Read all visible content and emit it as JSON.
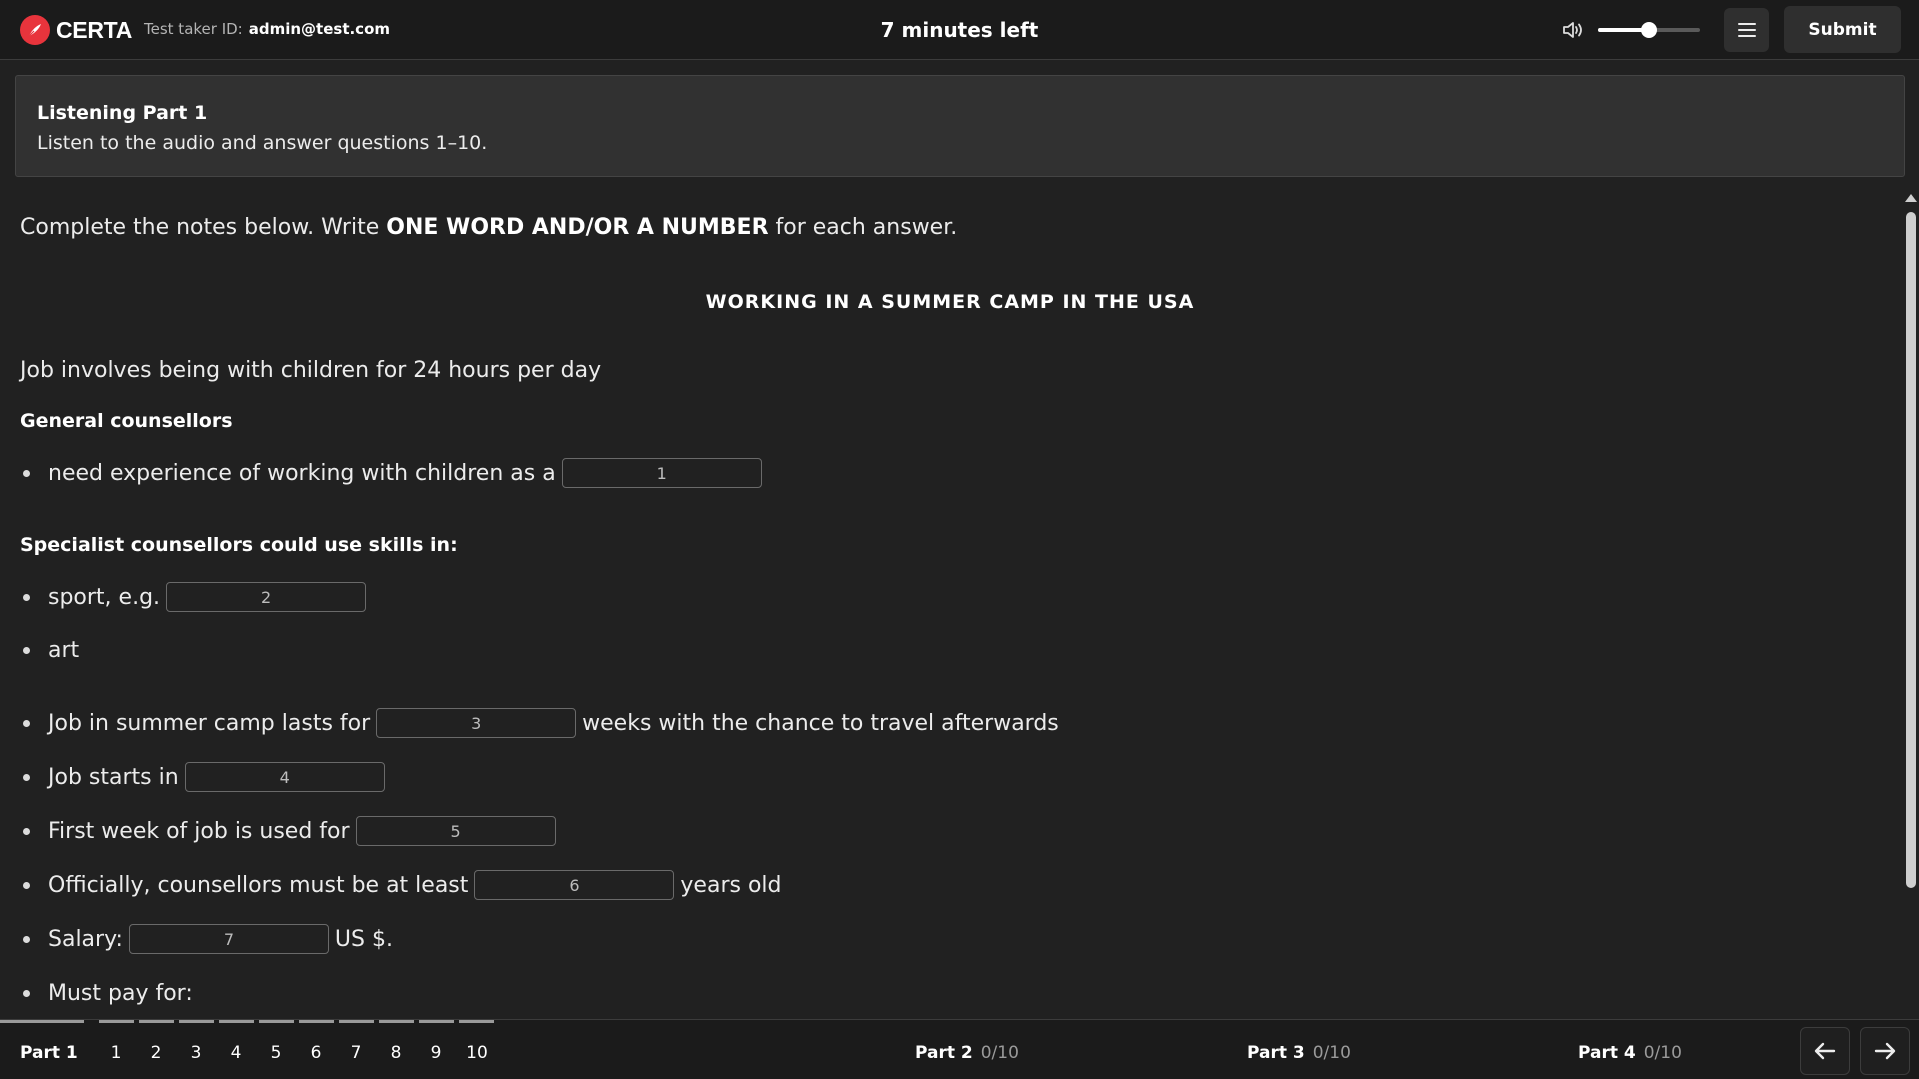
{
  "header": {
    "brand": "CERTA",
    "taker_label": "Test taker ID:",
    "taker_id": "admin@test.com",
    "timer": "7 minutes left",
    "volume_fraction": 0.5,
    "submit_label": "Submit",
    "icons": [
      "certa-logo-icon",
      "speaker-icon",
      "hamburger-menu-icon"
    ]
  },
  "banner": {
    "title": "Listening Part 1",
    "subtitle": "Listen to the audio and answer questions 1–10."
  },
  "content": {
    "instruction_prefix": "Complete the notes below. Write ",
    "instruction_bold": "ONE WORD AND/OR A NUMBER",
    "instruction_suffix": " for each answer.",
    "title": "WORKING IN A SUMMER CAMP IN THE USA",
    "intro": "Job involves being with children for 24 hours per day",
    "general_heading": "General counsellors",
    "q1_before": "need experience of working with children as a",
    "q1_placeholder": "1",
    "specialist_heading": "Specialist counsellors could use skills in:",
    "q2_before": "sport, e.g.",
    "q2_placeholder": "2",
    "art": "art",
    "q3_before": "Job in summer camp lasts for",
    "q3_placeholder": "3",
    "q3_after": "weeks with the chance to travel afterwards",
    "q4_before": "Job starts in",
    "q4_placeholder": "4",
    "q5_before": "First week of job is used for",
    "q5_placeholder": "5",
    "q6_before": "Officially, counsellors must be at least",
    "q6_placeholder": "6",
    "q6_after": "years old",
    "q7_before": "Salary:",
    "q7_placeholder": "7",
    "q7_after": "US $.",
    "must_pay": "Must pay for:"
  },
  "footer": {
    "part1_label": "Part 1",
    "questions": [
      "1",
      "2",
      "3",
      "4",
      "5",
      "6",
      "7",
      "8",
      "9",
      "10"
    ],
    "part2_label": "Part 2",
    "part2_score": "0/10",
    "part3_label": "Part 3",
    "part3_score": "0/10",
    "part4_label": "Part 4",
    "part4_score": "0/10",
    "icons": [
      "arrow-left-icon",
      "arrow-right-icon"
    ]
  }
}
